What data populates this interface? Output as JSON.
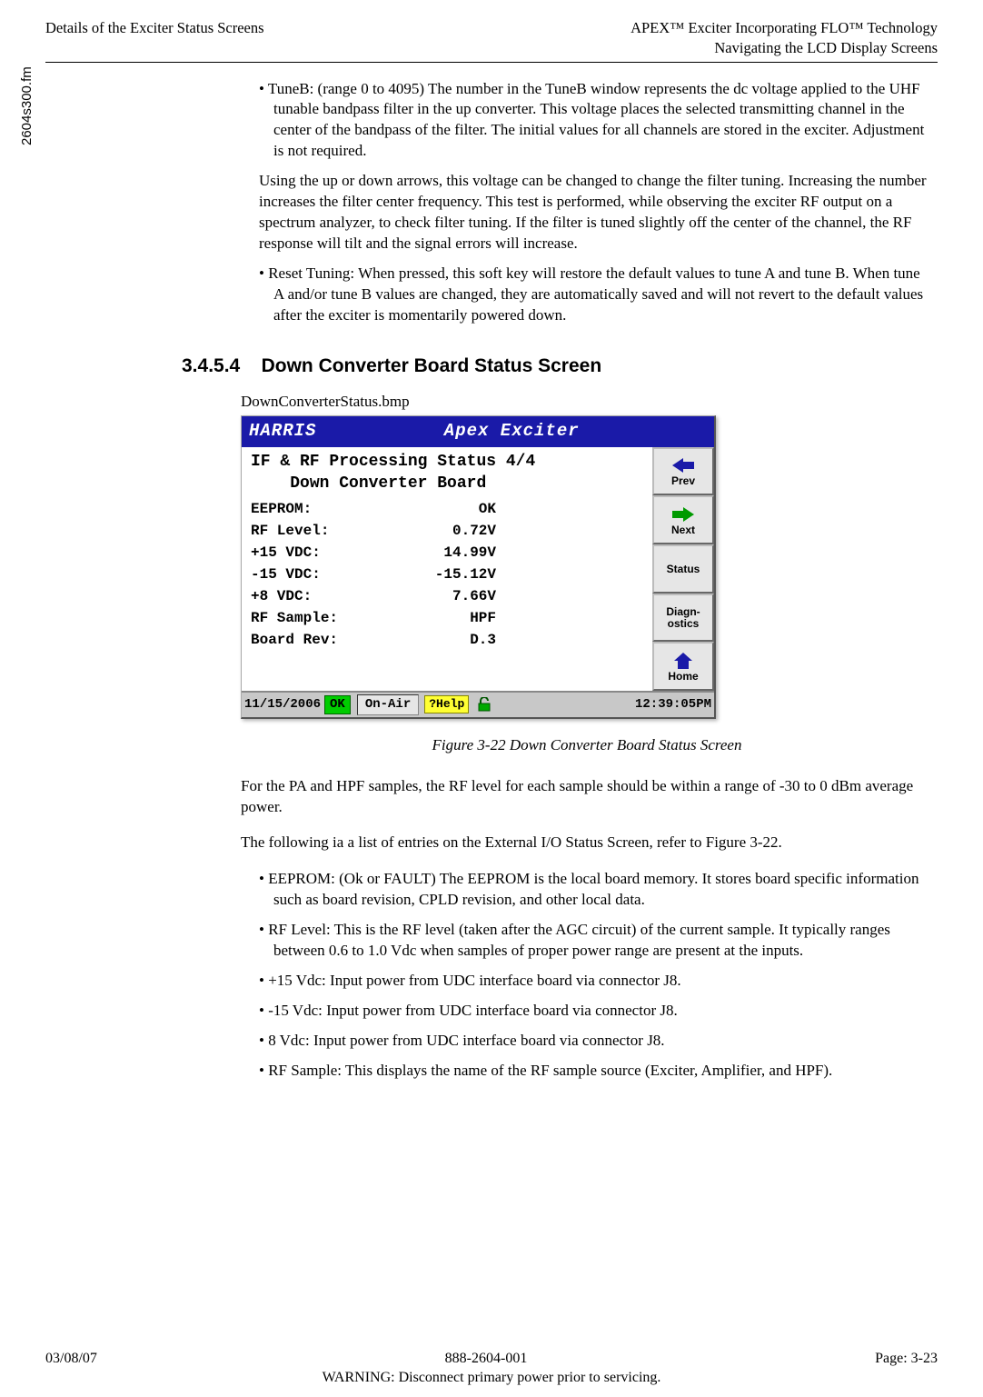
{
  "header": {
    "left": "Details of the Exciter Status Screens",
    "right_top": "APEX™ Exciter Incorporating FLO™ Technology",
    "right_bot": "Navigating the LCD Display Screens"
  },
  "side_label": "2604s300.fm",
  "bullets_top": [
    "TuneB: (range 0 to 4095) The number in the TuneB window represents the dc voltage applied to the UHF tunable bandpass filter in the up converter. This voltage places the selected transmitting channel in the center of the bandpass of the filter. The initial values for all channels are stored in the exciter. Adjustment is not required."
  ],
  "sub_para": "Using the up or down arrows, this voltage can be changed to change the filter tuning. Increasing the number increases the filter center frequency. This test is performed, while observing the exciter RF output on a spectrum analyzer, to check filter tuning. If the filter is tuned slightly off the center of the channel, the RF response will tilt and the signal errors will increase.",
  "bullets_top2": [
    "Reset Tuning: When pressed, this soft key will restore the default values to tune A and tune B. When tune A and/or tune B values are changed, they are automatically saved and will not revert to the default values after the exciter is momentarily powered down."
  ],
  "section_num": "3.4.5.4",
  "section_title": "Down Converter Board Status Screen",
  "bmp_label": "DownConverterStatus.bmp",
  "lcd": {
    "brand_text": "HARRIS",
    "app_title": "Apex Exciter",
    "heading_l1": "IF & RF Processing Status 4/4",
    "heading_l2": "Down Converter Board",
    "rows": [
      {
        "label": "EEPROM:",
        "value": "OK"
      },
      {
        "label": "RF Level:",
        "value": "0.72V"
      },
      {
        "label": "+15 VDC:",
        "value": "14.99V"
      },
      {
        "label": "-15 VDC:",
        "value": "-15.12V"
      },
      {
        "label": "+8 VDC:",
        "value": "7.66V"
      },
      {
        "label": "RF Sample:",
        "value": "HPF"
      },
      {
        "label": "Board Rev:",
        "value": "D.3"
      }
    ],
    "side_buttons": [
      "Prev",
      "Next",
      "Status",
      "Diagn-\nostics",
      "Home"
    ],
    "status": {
      "date": "11/15/2006",
      "ok": "OK",
      "onair": "On-Air",
      "help": "?Help",
      "time": "12:39:05PM"
    }
  },
  "fig_caption": "Figure 3-22  Down Converter Board Status Screen",
  "para1": "For the PA and HPF samples, the RF level for each sample should be within a range of -30 to 0 dBm average power.",
  "para2": "The following ia a list of entries on the External I/O Status Screen, refer to Figure 3-22.",
  "bullets_bottom": [
    "EEPROM: (Ok or FAULT) The EEPROM is the local board memory. It stores board specific information such as board revision, CPLD revision, and other local data.",
    "RF Level: This is the RF level (taken after the AGC circuit) of the current sample. It typically ranges between 0.6 to 1.0 Vdc when samples of proper power range are present at the inputs.",
    "+15 Vdc: Input power from UDC interface board via connector J8.",
    "-15 Vdc: Input power from UDC interface board via connector J8.",
    "8 Vdc: Input power from UDC interface board via connector J8.",
    "RF Sample: This displays the name of the RF sample source (Exciter, Amplifier, and HPF)."
  ],
  "footer": {
    "date": "03/08/07",
    "docnum": "888-2604-001",
    "page": "Page: 3-23",
    "warning": "WARNING: Disconnect primary power prior to servicing."
  }
}
